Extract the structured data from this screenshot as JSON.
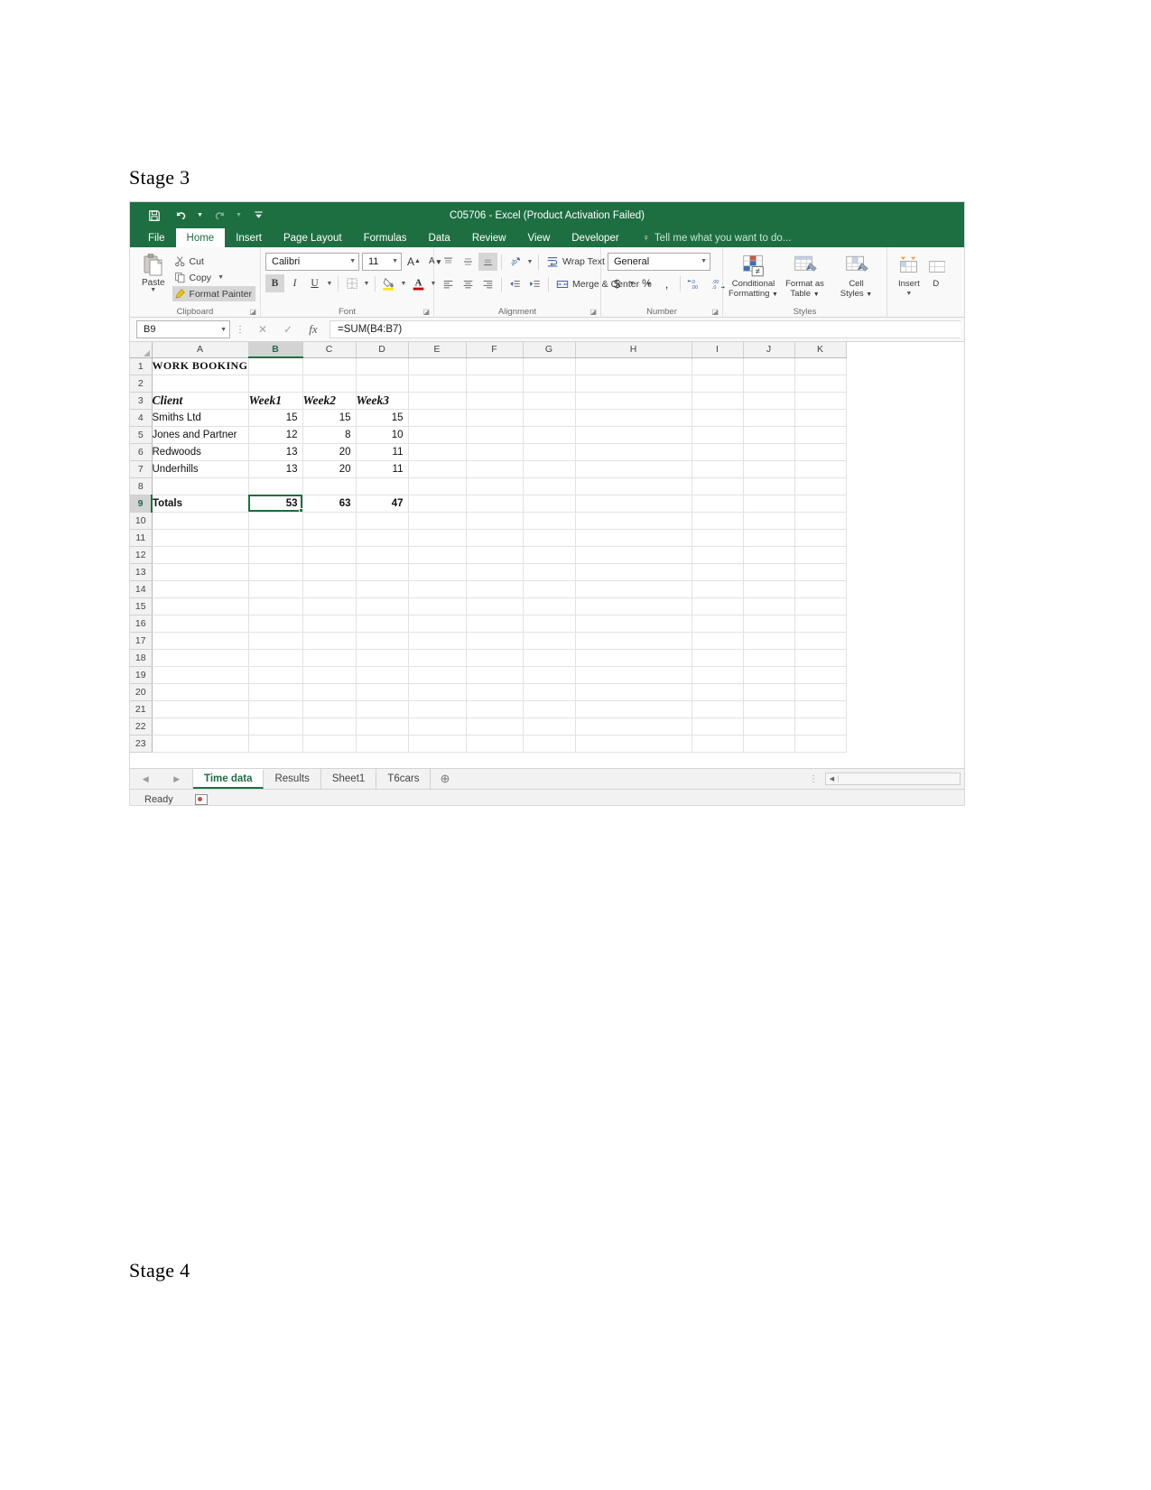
{
  "document": {
    "stage3_heading": "Stage 3",
    "stage4_heading": "Stage 4"
  },
  "titlebar": {
    "title": "C05706 - Excel (Product Activation Failed)",
    "quick_access": [
      {
        "name": "save-icon",
        "label": "Save"
      },
      {
        "name": "undo-icon",
        "label": "Undo"
      },
      {
        "name": "redo-icon",
        "label": "Redo"
      },
      {
        "name": "customize-qat-icon",
        "label": "Customize Quick Access Toolbar"
      }
    ]
  },
  "ribbon": {
    "tabs": [
      {
        "label": "File",
        "active": false
      },
      {
        "label": "Home",
        "active": true
      },
      {
        "label": "Insert",
        "active": false
      },
      {
        "label": "Page Layout",
        "active": false
      },
      {
        "label": "Formulas",
        "active": false
      },
      {
        "label": "Data",
        "active": false
      },
      {
        "label": "Review",
        "active": false
      },
      {
        "label": "View",
        "active": false
      },
      {
        "label": "Developer",
        "active": false
      }
    ],
    "tell_me": "Tell me what you want to do...",
    "groups": {
      "clipboard": {
        "label": "Clipboard",
        "paste": "Paste",
        "cut": "Cut",
        "copy": "Copy",
        "format_painter": "Format Painter"
      },
      "font": {
        "label": "Font",
        "font_name": "Calibri",
        "font_size": "11",
        "bold": "B",
        "italic": "I",
        "underline": "U",
        "grow_font": "A",
        "shrink_font": "A",
        "borders": "Borders",
        "fill_color": "Fill Color",
        "font_color": "Font Color"
      },
      "alignment": {
        "label": "Alignment",
        "wrap_text": "Wrap Text",
        "merge_center": "Merge & Center",
        "orientation": "Orientation",
        "decrease_indent": "Decrease Indent",
        "increase_indent": "Increase Indent"
      },
      "number": {
        "label": "Number",
        "format": "General",
        "accounting": "$",
        "percent": "%",
        "comma": ",",
        "increase_decimal": ".00",
        "decrease_decimal": ".00"
      },
      "styles": {
        "label": "Styles",
        "conditional_formatting": "Conditional\nFormatting",
        "conditional_formatting_l1": "Conditional",
        "conditional_formatting_l2": "Formatting",
        "format_as_table_l1": "Format as",
        "format_as_table_l2": "Table",
        "cell_styles_l1": "Cell",
        "cell_styles_l2": "Styles"
      }
    }
  },
  "formula_bar": {
    "name_box": "B9",
    "formula": "=SUM(B4:B7)",
    "cancel_icon": "✕",
    "enter_icon": "✓",
    "function_icon": "fx"
  },
  "sheet": {
    "columns": [
      "A",
      "B",
      "C",
      "D",
      "E",
      "F",
      "G",
      "H",
      "I",
      "J",
      "K"
    ],
    "selected_column": "B",
    "selected_row": 9,
    "selected_cell": "B9",
    "rows": [
      {
        "n": 1,
        "cells": {
          "A": "WORK BOOKING"
        }
      },
      {
        "n": 2,
        "cells": {}
      },
      {
        "n": 3,
        "cells": {
          "A": "Client",
          "B": "Week1",
          "C": "Week2",
          "D": "Week3"
        }
      },
      {
        "n": 4,
        "cells": {
          "A": "Smiths Ltd",
          "B": "15",
          "C": "15",
          "D": "15"
        }
      },
      {
        "n": 5,
        "cells": {
          "A": "Jones and Partner",
          "B": "12",
          "C": "8",
          "D": "10"
        }
      },
      {
        "n": 6,
        "cells": {
          "A": "Redwoods",
          "B": "13",
          "C": "20",
          "D": "11"
        }
      },
      {
        "n": 7,
        "cells": {
          "A": "Underhills",
          "B": "13",
          "C": "20",
          "D": "11"
        }
      },
      {
        "n": 8,
        "cells": {}
      },
      {
        "n": 9,
        "cells": {
          "A": "Totals",
          "B": "53",
          "C": "63",
          "D": "47"
        }
      },
      {
        "n": 10,
        "cells": {}
      },
      {
        "n": 11,
        "cells": {}
      },
      {
        "n": 12,
        "cells": {}
      },
      {
        "n": 13,
        "cells": {}
      },
      {
        "n": 14,
        "cells": {}
      },
      {
        "n": 15,
        "cells": {}
      },
      {
        "n": 16,
        "cells": {}
      },
      {
        "n": 17,
        "cells": {}
      },
      {
        "n": 18,
        "cells": {}
      },
      {
        "n": 19,
        "cells": {}
      },
      {
        "n": 20,
        "cells": {}
      },
      {
        "n": 21,
        "cells": {}
      },
      {
        "n": 22,
        "cells": {}
      },
      {
        "n": 23,
        "cells": {}
      }
    ]
  },
  "sheet_tabs": {
    "tabs": [
      {
        "label": "Time data",
        "active": true
      },
      {
        "label": "Results",
        "active": false
      },
      {
        "label": "Sheet1",
        "active": false
      },
      {
        "label": "T6cars",
        "active": false
      }
    ],
    "add_sheet": "⊕",
    "prev_icon": "◀",
    "next_icon": "▶"
  },
  "status_bar": {
    "status": "Ready",
    "macro_record": "Record Macro"
  }
}
